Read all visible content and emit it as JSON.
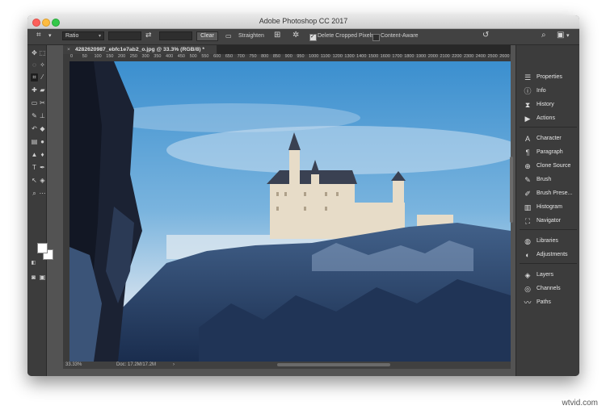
{
  "window": {
    "title": "Adobe Photoshop CC 2017"
  },
  "options_bar": {
    "ratio_label": "Ratio",
    "clear_label": "Clear",
    "straighten_label": "Straighten",
    "delete_cropped_label": "Delete Cropped Pixels",
    "delete_cropped_checked": true,
    "content_aware_label": "Content-Aware",
    "content_aware_checked": false
  },
  "document": {
    "tab_title": "4282620987_ebfc1e7ab2_o.jpg @ 33.3% (RGB/8) *",
    "ruler_ticks": [
      "0",
      "50",
      "100",
      "150",
      "200",
      "250",
      "300",
      "350",
      "400",
      "450",
      "500",
      "550",
      "600",
      "650",
      "700",
      "750",
      "800",
      "850",
      "900",
      "950",
      "1000",
      "1100",
      "1200",
      "1300",
      "1400",
      "1500",
      "1600",
      "1700",
      "1800",
      "1900",
      "2000",
      "2100",
      "2200",
      "2300",
      "2400",
      "2500",
      "2600"
    ],
    "zoom": "33.33%",
    "doc_size": "Doc: 17.2M/17.2M"
  },
  "panels": [
    {
      "label": "Properties",
      "icon": "properties-icon"
    },
    {
      "label": "Info",
      "icon": "info-icon"
    },
    {
      "label": "History",
      "icon": "history-icon"
    },
    {
      "label": "Actions",
      "icon": "actions-icon"
    },
    {
      "label": "Character",
      "icon": "character-icon"
    },
    {
      "label": "Paragraph",
      "icon": "paragraph-icon"
    },
    {
      "label": "Clone Source",
      "icon": "clone-source-icon"
    },
    {
      "label": "Brush",
      "icon": "brush-icon"
    },
    {
      "label": "Brush Prese...",
      "icon": "brush-presets-icon"
    },
    {
      "label": "Histogram",
      "icon": "histogram-icon"
    },
    {
      "label": "Navigator",
      "icon": "navigator-icon"
    },
    {
      "label": "Libraries",
      "icon": "libraries-icon"
    },
    {
      "label": "Adjustments",
      "icon": "adjustments-icon"
    },
    {
      "label": "Layers",
      "icon": "layers-icon"
    },
    {
      "label": "Channels",
      "icon": "channels-icon"
    },
    {
      "label": "Paths",
      "icon": "paths-icon"
    }
  ],
  "colors": {
    "foreground": "#ffffff",
    "background": "#ffffff",
    "ui_dark": "#3c3c3c"
  },
  "watermark": "wtvid.com"
}
